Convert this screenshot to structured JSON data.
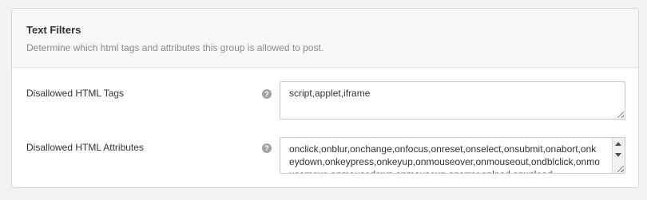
{
  "panel": {
    "title": "Text Filters",
    "description": "Determine which html tags and attributes this group is allowed to post."
  },
  "fields": [
    {
      "label": "Disallowed HTML Tags",
      "help_icon": "question-mark",
      "value": "script,applet,iframe"
    },
    {
      "label": "Disallowed HTML Attributes",
      "help_icon": "question-mark",
      "value": "onclick,onblur,onchange,onfocus,onreset,onselect,onsubmit,onabort,onkeydown,onkeypress,onkeyup,onmouseover,onmouseout,ondblclick,onmousemove,onmousedown,onmouseup,onerror,onload,onunload"
    }
  ],
  "icons": {
    "help_glyph": "?"
  },
  "colors": {
    "header_bg": "#f7f7f7",
    "help_icon": "#a3a3a3",
    "border": "#c9c9c9"
  }
}
